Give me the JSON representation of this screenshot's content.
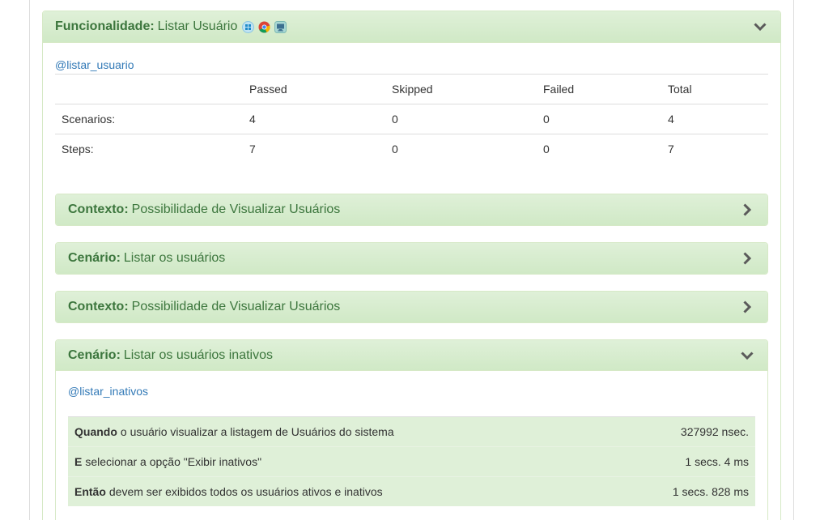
{
  "feature": {
    "keyword": "Funcionalidade:",
    "name": "Listar Usuário",
    "platform_icons": [
      "windows-icon",
      "chrome-icon",
      "desktop-icon"
    ],
    "tag": "@listar_usuario",
    "stats": {
      "headers": [
        "",
        "Passed",
        "Skipped",
        "Failed",
        "Total"
      ],
      "rows": [
        {
          "label": "Scenarios:",
          "passed": "4",
          "skipped": "0",
          "failed": "0",
          "total": "4"
        },
        {
          "label": "Steps:",
          "passed": "7",
          "skipped": "0",
          "failed": "0",
          "total": "7"
        }
      ]
    }
  },
  "elements": [
    {
      "keyword": "Contexto:",
      "name": "Possibilidade de Visualizar Usuários",
      "state": "collapsed"
    },
    {
      "keyword": "Cenário:",
      "name": "Listar os usuários",
      "state": "collapsed"
    },
    {
      "keyword": "Contexto:",
      "name": "Possibilidade de Visualizar Usuários",
      "state": "collapsed"
    },
    {
      "keyword": "Cenário:",
      "name": "Listar os usuários inativos",
      "state": "expanded",
      "tag": "@listar_inativos",
      "steps": [
        {
          "keyword": "Quando",
          "text": "o usuário visualizar a listagem de Usuários do sistema",
          "duration": "327992 nsec."
        },
        {
          "keyword": "E",
          "text": "selecionar a opção \"Exibir inativos\"",
          "duration": "1 secs. 4 ms"
        },
        {
          "keyword": "Então",
          "text": "devem ser exibidos todos os usuários ativos e inativos",
          "duration": "1 secs. 828 ms"
        }
      ]
    }
  ],
  "colors": {
    "panel_bg": "#dff0d8",
    "panel_text": "#3c763d",
    "link": "#337ab7"
  }
}
